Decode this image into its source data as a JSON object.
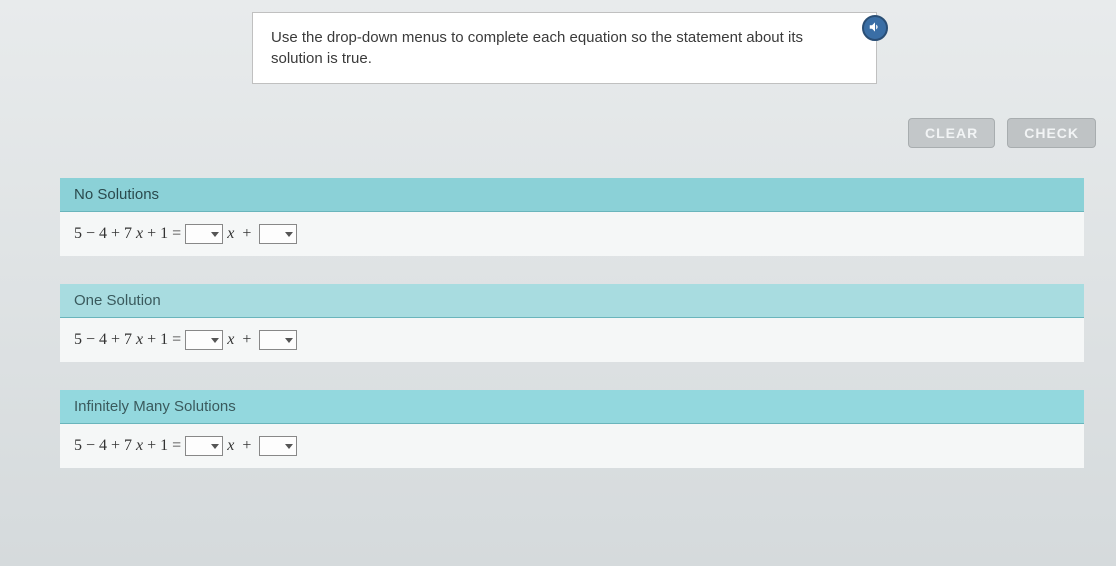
{
  "instruction": "Use the drop-down menus to complete each equation so the statement about its solution is true.",
  "buttons": {
    "clear": "CLEAR",
    "check": "CHECK"
  },
  "sections": [
    {
      "title": "No Solutions",
      "equation_lhs": "5 − 4 + 7",
      "equation_var1": "x",
      "equation_mid": " + 1 = ",
      "equation_var2": "x",
      "equation_plus": " + "
    },
    {
      "title": "One Solution",
      "equation_lhs": "5 − 4 + 7",
      "equation_var1": "x",
      "equation_mid": " + 1 = ",
      "equation_var2": "x",
      "equation_plus": " + "
    },
    {
      "title": "Infinitely Many Solutions",
      "equation_lhs": "5 − 4 + 7",
      "equation_var1": "x",
      "equation_mid": " + 1 = ",
      "equation_var2": "x",
      "equation_plus": " + "
    }
  ],
  "icons": {
    "audio": "🔊"
  }
}
